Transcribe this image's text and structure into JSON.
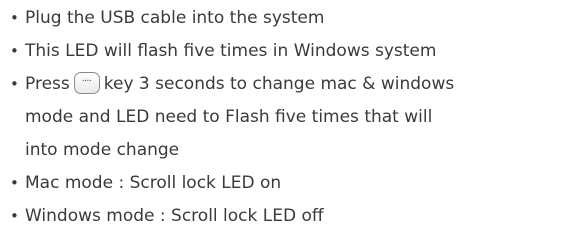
{
  "instructions": {
    "items": [
      {
        "text": "Plug the USB cable into the system"
      },
      {
        "text": "This LED will flash five times in Windows system"
      },
      {
        "text_before_key": "Press",
        "key_icon": "keycap-icon",
        "key_label": "••••",
        "text_after_key": "key 3 seconds to change mac & windows",
        "line2": "mode and LED need to  Flash five times that will",
        "line3": "into mode change"
      },
      {
        "text": "Mac mode : Scroll lock LED on"
      },
      {
        "text": "Windows mode : Scroll lock LED off"
      }
    ]
  }
}
